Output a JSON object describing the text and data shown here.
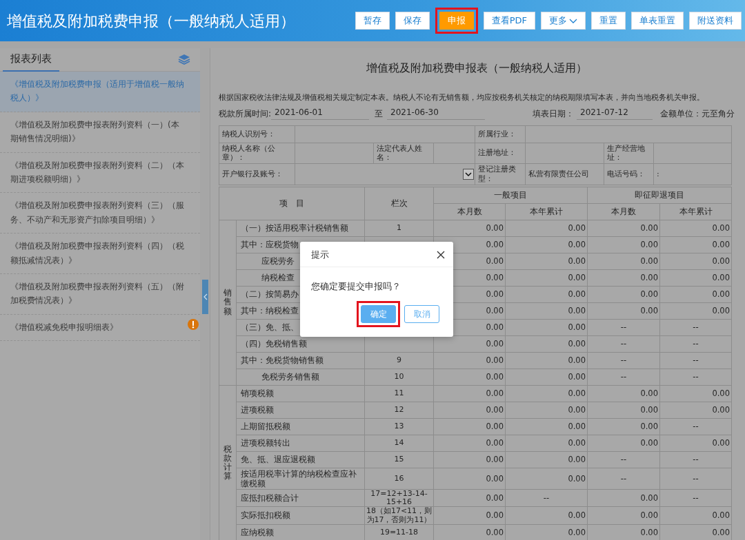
{
  "header": {
    "title": "增值税及附加税费申报（一般纳税人适用）",
    "buttons": [
      {
        "label": "暂存",
        "kind": "plain",
        "highlighted": false
      },
      {
        "label": "保存",
        "kind": "plain",
        "highlighted": false
      },
      {
        "label": "申报",
        "kind": "primary",
        "highlighted": true
      },
      {
        "label": "查看PDF",
        "kind": "plain",
        "highlighted": false
      },
      {
        "label": "更多",
        "kind": "dropdown",
        "highlighted": false
      },
      {
        "label": "重置",
        "kind": "plain",
        "highlighted": false
      },
      {
        "label": "单表重置",
        "kind": "plain",
        "highlighted": false
      },
      {
        "label": "附送资料",
        "kind": "plain",
        "highlighted": false
      }
    ]
  },
  "sidebar": {
    "title": "报表列表",
    "items": [
      {
        "label": "《增值税及附加税费申报（适用于增值税一般纳税人）》",
        "selected": true,
        "warning": false
      },
      {
        "label": "《增值税及附加税费申报表附列资料（一）(本期销售情况明细)》",
        "selected": false,
        "warning": false
      },
      {
        "label": "《增值税及附加税费申报表附列资料（二）（本期进项税额明细）》",
        "selected": false,
        "warning": false
      },
      {
        "label": "《增值税及附加税费申报表附列资料（三）（服务、不动产和无形资产扣除项目明细）》",
        "selected": false,
        "warning": false
      },
      {
        "label": "《增值税及附加税费申报表附列资料（四）（税额抵减情况表）》",
        "selected": false,
        "warning": false
      },
      {
        "label": "《增值税及附加税费申报表附列资料（五）（附加税费情况表）》",
        "selected": false,
        "warning": false
      },
      {
        "label": "《增值税减免税申报明细表》",
        "selected": false,
        "warning": true
      }
    ]
  },
  "form": {
    "title": "增值税及附加税费申报表（一般纳税人适用）",
    "note": "根据国家税收法律法规及增值税相关规定制定本表。纳税人不论有无销售额，均应按税务机关核定的纳税期限填写本表，并向当地税务机关申报。",
    "period_label": "税款所属时间:",
    "period_from": "2021-06-01",
    "period_to_label": "至",
    "period_to": "2021-06-30",
    "fill_date_label": "填表日期：",
    "fill_date": "2021-07-12",
    "unit": "金额单位：元至角分",
    "info_fields": [
      {
        "label": "纳税人识别号："
      },
      {
        "label": "所属行业："
      },
      {
        "label": "纳税人名称（公章）："
      },
      {
        "label": "法定代表人姓名："
      },
      {
        "label": "注册地址："
      },
      {
        "label": "生产经营地址："
      },
      {
        "label": "开户银行及账号：",
        "kind": "dropdown"
      },
      {
        "label": "登记注册类型：",
        "value": "私营有限责任公司"
      },
      {
        "label": "电话号码：",
        "value": ":"
      }
    ],
    "columns": {
      "item": "项　目",
      "line": "栏次",
      "general": "一般项目",
      "immediate": "即征即退项目",
      "sub": [
        "本月数",
        "本年累计",
        "本月数",
        "本年累计"
      ]
    },
    "groups": [
      {
        "label": "销售额",
        "rows": [
          {
            "item": "（一）按适用税率计税销售额",
            "kind": "main",
            "line": "1",
            "values": [
              "0.00",
              "0.00",
              "0.00",
              "0.00"
            ],
            "applicable": [
              true,
              true,
              true,
              true
            ]
          },
          {
            "item": "其中：应税货物",
            "kind": "main",
            "values": [
              "0.00",
              "0.00",
              "0.00",
              "0.00"
            ],
            "applicable": [
              true,
              true,
              true,
              true
            ]
          },
          {
            "item": "应税劳务",
            "kind": "sub",
            "values": [
              "0.00",
              "0.00",
              "0.00",
              "0.00"
            ],
            "applicable": [
              true,
              true,
              true,
              true
            ]
          },
          {
            "item": "纳税检查",
            "kind": "sub",
            "values": [
              "0.00",
              "0.00",
              "0.00",
              "0.00"
            ],
            "applicable": [
              true,
              true,
              true,
              true
            ]
          },
          {
            "item": "（二）按简易办",
            "kind": "main",
            "values": [
              "0.00",
              "0.00",
              "0.00",
              "0.00"
            ],
            "applicable": [
              true,
              true,
              true,
              true
            ]
          },
          {
            "item": "其中：纳税检查",
            "kind": "main",
            "values": [
              "0.00",
              "0.00",
              "0.00",
              "0.00"
            ],
            "applicable": [
              true,
              true,
              true,
              true
            ]
          },
          {
            "item": "（三）免、抵、",
            "kind": "main",
            "values": [
              "0.00",
              "0.00",
              "--",
              "--"
            ],
            "applicable": [
              true,
              true,
              false,
              false
            ]
          },
          {
            "item": "（四）免税销售额",
            "kind": "main",
            "values": [
              "0.00",
              "0.00",
              "--",
              "--"
            ],
            "applicable": [
              true,
              true,
              false,
              false
            ]
          },
          {
            "item": "其中：免税货物销售额",
            "kind": "main",
            "line": "9",
            "values": [
              "0.00",
              "0.00",
              "--",
              "--"
            ],
            "applicable": [
              true,
              true,
              false,
              false
            ]
          },
          {
            "item": "免税劳务销售额",
            "kind": "sub",
            "line": "10",
            "values": [
              "0.00",
              "0.00",
              "--",
              "--"
            ],
            "applicable": [
              true,
              true,
              false,
              false
            ]
          }
        ]
      },
      {
        "label": "税款计算",
        "rows": [
          {
            "item": "销项税额",
            "kind": "main",
            "line": "11",
            "values": [
              "0.00",
              "0.00",
              "0.00",
              "0.00"
            ],
            "applicable": [
              true,
              true,
              true,
              true
            ]
          },
          {
            "item": "进项税额",
            "kind": "main",
            "line": "12",
            "values": [
              "0.00",
              "0.00",
              "0.00",
              "0.00"
            ],
            "applicable": [
              true,
              true,
              true,
              true
            ]
          },
          {
            "item": "上期留抵税额",
            "kind": "main",
            "line": "13",
            "values": [
              "0.00",
              "0.00",
              "0.00",
              "--"
            ],
            "applicable": [
              true,
              true,
              true,
              false
            ]
          },
          {
            "item": "进项税额转出",
            "kind": "main",
            "line": "14",
            "values": [
              "0.00",
              "0.00",
              "0.00",
              "0.00"
            ],
            "applicable": [
              true,
              true,
              true,
              true
            ]
          },
          {
            "item": "免、抵、退应退税额",
            "kind": "main",
            "line": "15",
            "values": [
              "0.00",
              "0.00",
              "--",
              "--"
            ],
            "applicable": [
              true,
              true,
              false,
              false
            ]
          },
          {
            "item": "按适用税率计算的纳税检查应补缴税额",
            "kind": "main",
            "line": "16",
            "values": [
              "0.00",
              "0.00",
              "--",
              "--"
            ],
            "applicable": [
              true,
              true,
              false,
              false
            ]
          },
          {
            "item": "应抵扣税额合计",
            "kind": "main",
            "line": "17=12+13-14-15+16",
            "values": [
              "0.00",
              "--",
              "0.00",
              "--"
            ],
            "applicable": [
              true,
              false,
              true,
              false
            ]
          },
          {
            "item": "实际抵扣税额",
            "kind": "main",
            "line": "18（如17<11，则为17，否则为11）",
            "values": [
              "0.00",
              "0.00",
              "0.00",
              "0.00"
            ],
            "applicable": [
              true,
              true,
              true,
              true
            ]
          },
          {
            "item": "应纳税额",
            "kind": "main",
            "line": "19=11-18",
            "values": [
              "0.00",
              "0.00",
              "0.00",
              "0.00"
            ],
            "applicable": [
              true,
              true,
              true,
              true
            ]
          }
        ]
      }
    ]
  },
  "dialog": {
    "title": "提示",
    "message": "您确定要提交申报吗？",
    "buttons": [
      {
        "label": "确定",
        "kind": "primary",
        "highlighted": true
      },
      {
        "label": "取消",
        "kind": "plain",
        "highlighted": false
      }
    ]
  }
}
